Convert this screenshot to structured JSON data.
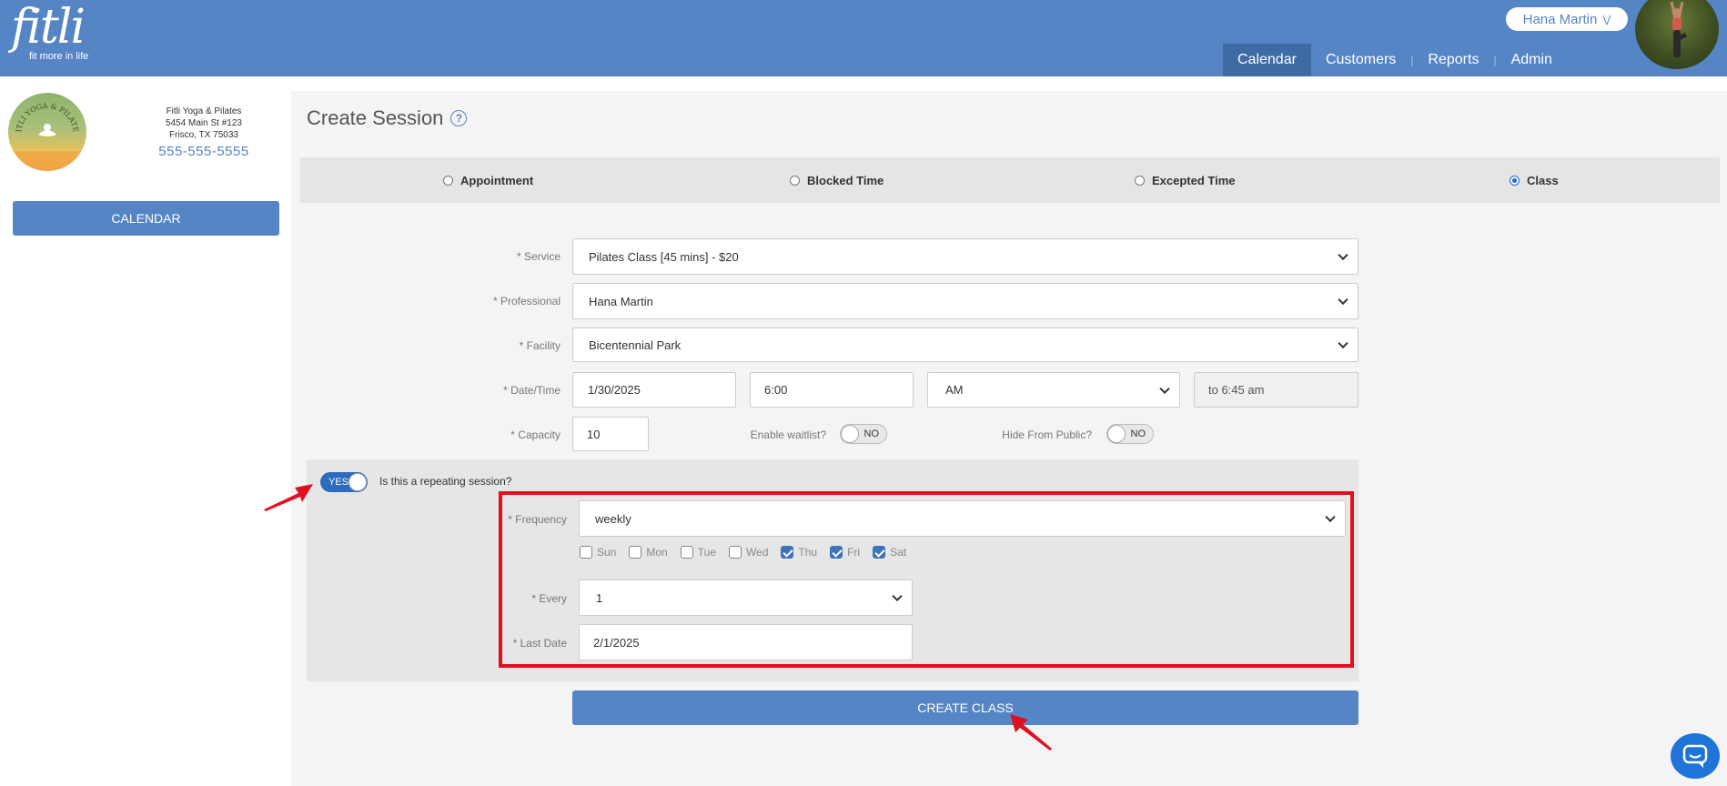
{
  "header": {
    "logo": "fitli",
    "tagline": "fit more in life",
    "user_name": "Hana Martin",
    "nav": [
      "Calendar",
      "Customers",
      "Reports",
      "Admin"
    ],
    "active_nav": "Calendar"
  },
  "sidebar": {
    "studio_logo_text": "FITLI YOGA & PILATES",
    "studio_name": "Fitli Yoga & Pilates",
    "address_line1": "5454 Main St #123",
    "address_line2": "Frisco, TX 75033",
    "phone": "555-555-5555",
    "calendar_button": "CALENDAR"
  },
  "page": {
    "title": "Create Session",
    "help_icon": "?"
  },
  "session_types": {
    "appointment": "Appointment",
    "blocked_time": "Blocked Time",
    "excepted_time": "Excepted Time",
    "class": "Class",
    "selected": "Class"
  },
  "form": {
    "service_label": "* Service",
    "service_value": "Pilates Class [45 mins] - $20",
    "professional_label": "* Professional",
    "professional_value": "Hana Martin",
    "facility_label": "* Facility",
    "facility_value": "Bicentennial Park",
    "datetime_label": "* Date/Time",
    "date_value": "1/30/2025",
    "time_value": "6:00",
    "ampm_value": "AM",
    "end_time": "to 6:45 am",
    "capacity_label": "* Capacity",
    "capacity_value": "10",
    "waitlist_label": "Enable waitlist?",
    "waitlist_state": "NO",
    "hide_label": "Hide From Public?",
    "hide_state": "NO"
  },
  "repeat": {
    "toggle_state": "YES",
    "question": "Is this a repeating session?",
    "frequency_label": "* Frequency",
    "frequency_value": "weekly",
    "days": [
      {
        "label": "Sun",
        "checked": false
      },
      {
        "label": "Mon",
        "checked": false
      },
      {
        "label": "Tue",
        "checked": false
      },
      {
        "label": "Wed",
        "checked": false
      },
      {
        "label": "Thu",
        "checked": true
      },
      {
        "label": "Fri",
        "checked": true
      },
      {
        "label": "Sat",
        "checked": true
      }
    ],
    "every_label": "* Every",
    "every_value": "1",
    "last_date_label": "* Last Date",
    "last_date_value": "2/1/2025"
  },
  "actions": {
    "create_class": "CREATE CLASS"
  },
  "colors": {
    "brand_blue": "#5585c5",
    "nav_active": "#3e6aa6",
    "highlight_red": "#e01020",
    "chat_blue": "#1e74d8"
  }
}
